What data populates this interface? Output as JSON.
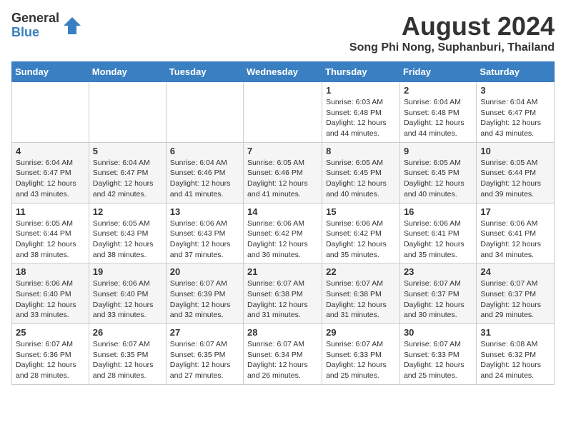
{
  "logo": {
    "general": "General",
    "blue": "Blue"
  },
  "title": {
    "month_year": "August 2024",
    "location": "Song Phi Nong, Suphanburi, Thailand"
  },
  "days_of_week": [
    "Sunday",
    "Monday",
    "Tuesday",
    "Wednesday",
    "Thursday",
    "Friday",
    "Saturday"
  ],
  "weeks": [
    [
      {
        "num": "",
        "info": ""
      },
      {
        "num": "",
        "info": ""
      },
      {
        "num": "",
        "info": ""
      },
      {
        "num": "",
        "info": ""
      },
      {
        "num": "1",
        "info": "Sunrise: 6:03 AM\nSunset: 6:48 PM\nDaylight: 12 hours and 44 minutes."
      },
      {
        "num": "2",
        "info": "Sunrise: 6:04 AM\nSunset: 6:48 PM\nDaylight: 12 hours and 44 minutes."
      },
      {
        "num": "3",
        "info": "Sunrise: 6:04 AM\nSunset: 6:47 PM\nDaylight: 12 hours and 43 minutes."
      }
    ],
    [
      {
        "num": "4",
        "info": "Sunrise: 6:04 AM\nSunset: 6:47 PM\nDaylight: 12 hours and 43 minutes."
      },
      {
        "num": "5",
        "info": "Sunrise: 6:04 AM\nSunset: 6:47 PM\nDaylight: 12 hours and 42 minutes."
      },
      {
        "num": "6",
        "info": "Sunrise: 6:04 AM\nSunset: 6:46 PM\nDaylight: 12 hours and 41 minutes."
      },
      {
        "num": "7",
        "info": "Sunrise: 6:05 AM\nSunset: 6:46 PM\nDaylight: 12 hours and 41 minutes."
      },
      {
        "num": "8",
        "info": "Sunrise: 6:05 AM\nSunset: 6:45 PM\nDaylight: 12 hours and 40 minutes."
      },
      {
        "num": "9",
        "info": "Sunrise: 6:05 AM\nSunset: 6:45 PM\nDaylight: 12 hours and 40 minutes."
      },
      {
        "num": "10",
        "info": "Sunrise: 6:05 AM\nSunset: 6:44 PM\nDaylight: 12 hours and 39 minutes."
      }
    ],
    [
      {
        "num": "11",
        "info": "Sunrise: 6:05 AM\nSunset: 6:44 PM\nDaylight: 12 hours and 38 minutes."
      },
      {
        "num": "12",
        "info": "Sunrise: 6:05 AM\nSunset: 6:43 PM\nDaylight: 12 hours and 38 minutes."
      },
      {
        "num": "13",
        "info": "Sunrise: 6:06 AM\nSunset: 6:43 PM\nDaylight: 12 hours and 37 minutes."
      },
      {
        "num": "14",
        "info": "Sunrise: 6:06 AM\nSunset: 6:42 PM\nDaylight: 12 hours and 36 minutes."
      },
      {
        "num": "15",
        "info": "Sunrise: 6:06 AM\nSunset: 6:42 PM\nDaylight: 12 hours and 35 minutes."
      },
      {
        "num": "16",
        "info": "Sunrise: 6:06 AM\nSunset: 6:41 PM\nDaylight: 12 hours and 35 minutes."
      },
      {
        "num": "17",
        "info": "Sunrise: 6:06 AM\nSunset: 6:41 PM\nDaylight: 12 hours and 34 minutes."
      }
    ],
    [
      {
        "num": "18",
        "info": "Sunrise: 6:06 AM\nSunset: 6:40 PM\nDaylight: 12 hours and 33 minutes."
      },
      {
        "num": "19",
        "info": "Sunrise: 6:06 AM\nSunset: 6:40 PM\nDaylight: 12 hours and 33 minutes."
      },
      {
        "num": "20",
        "info": "Sunrise: 6:07 AM\nSunset: 6:39 PM\nDaylight: 12 hours and 32 minutes."
      },
      {
        "num": "21",
        "info": "Sunrise: 6:07 AM\nSunset: 6:38 PM\nDaylight: 12 hours and 31 minutes."
      },
      {
        "num": "22",
        "info": "Sunrise: 6:07 AM\nSunset: 6:38 PM\nDaylight: 12 hours and 31 minutes."
      },
      {
        "num": "23",
        "info": "Sunrise: 6:07 AM\nSunset: 6:37 PM\nDaylight: 12 hours and 30 minutes."
      },
      {
        "num": "24",
        "info": "Sunrise: 6:07 AM\nSunset: 6:37 PM\nDaylight: 12 hours and 29 minutes."
      }
    ],
    [
      {
        "num": "25",
        "info": "Sunrise: 6:07 AM\nSunset: 6:36 PM\nDaylight: 12 hours and 28 minutes."
      },
      {
        "num": "26",
        "info": "Sunrise: 6:07 AM\nSunset: 6:35 PM\nDaylight: 12 hours and 28 minutes."
      },
      {
        "num": "27",
        "info": "Sunrise: 6:07 AM\nSunset: 6:35 PM\nDaylight: 12 hours and 27 minutes."
      },
      {
        "num": "28",
        "info": "Sunrise: 6:07 AM\nSunset: 6:34 PM\nDaylight: 12 hours and 26 minutes."
      },
      {
        "num": "29",
        "info": "Sunrise: 6:07 AM\nSunset: 6:33 PM\nDaylight: 12 hours and 25 minutes."
      },
      {
        "num": "30",
        "info": "Sunrise: 6:07 AM\nSunset: 6:33 PM\nDaylight: 12 hours and 25 minutes."
      },
      {
        "num": "31",
        "info": "Sunrise: 6:08 AM\nSunset: 6:32 PM\nDaylight: 12 hours and 24 minutes."
      }
    ]
  ]
}
